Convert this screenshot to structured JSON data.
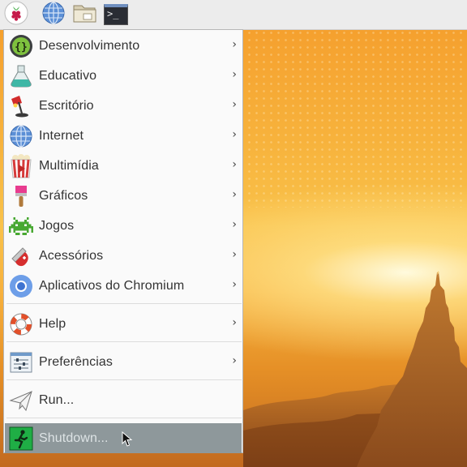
{
  "menu": {
    "items": [
      {
        "label": "Desenvolvimento",
        "icon": "code-braces-icon",
        "has_submenu": true
      },
      {
        "label": "Educativo",
        "icon": "flask-icon",
        "has_submenu": true
      },
      {
        "label": "Escritório",
        "icon": "desk-lamp-icon",
        "has_submenu": true
      },
      {
        "label": "Internet",
        "icon": "globe-icon",
        "has_submenu": true
      },
      {
        "label": "Multimídia",
        "icon": "popcorn-play-icon",
        "has_submenu": true
      },
      {
        "label": "Gráficos",
        "icon": "paintbrush-icon",
        "has_submenu": true
      },
      {
        "label": "Jogos",
        "icon": "space-invader-icon",
        "has_submenu": true
      },
      {
        "label": "Acessórios",
        "icon": "pocket-knife-icon",
        "has_submenu": true
      },
      {
        "label": "Aplicativos do Chromium",
        "icon": "chromium-icon",
        "has_submenu": true
      },
      {
        "label": "Help",
        "icon": "lifebuoy-icon",
        "has_submenu": true
      },
      {
        "label": "Preferências",
        "icon": "preferences-sliders-icon",
        "has_submenu": true
      },
      {
        "label": "Run...",
        "icon": "paper-plane-icon",
        "has_submenu": false
      },
      {
        "label": "Shutdown...",
        "icon": "exit-running-man-icon",
        "has_submenu": false,
        "selected": true
      }
    ],
    "submenu_arrow": "›"
  },
  "taskbar": {
    "launchers": [
      {
        "name": "raspberry-menu",
        "icon": "raspberry-icon"
      },
      {
        "name": "web-browser",
        "icon": "globe-icon"
      },
      {
        "name": "file-manager",
        "icon": "folder-icon"
      },
      {
        "name": "terminal",
        "icon": "terminal-icon",
        "glyph": ">_"
      }
    ]
  },
  "colors": {
    "panel_bg": "#ececec",
    "menu_bg": "#fafafa",
    "selected_bg": "#8e989b",
    "selected_text": "#dde3e5",
    "text": "#333333"
  }
}
